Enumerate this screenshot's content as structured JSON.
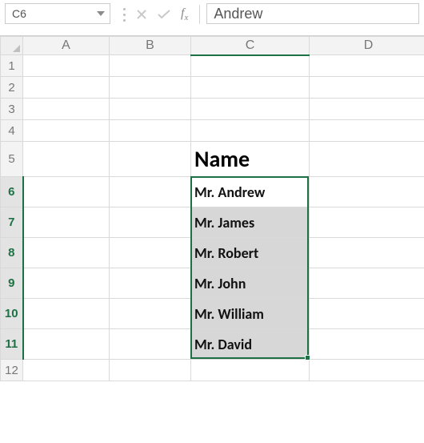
{
  "colors": {
    "accent": "#1e7145",
    "headerBg": "#f3f3f3",
    "selectionFill": "#d7d7d7"
  },
  "nameBox": {
    "value": "C6"
  },
  "formulaBar": {
    "value": "Andrew"
  },
  "columns": {
    "A": "A",
    "B": "B",
    "C": "C",
    "D": "D"
  },
  "rows": [
    "1",
    "2",
    "3",
    "4",
    "5",
    "6",
    "7",
    "8",
    "9",
    "10",
    "11",
    "12"
  ],
  "activeColumn": "C",
  "activeRows": [
    6,
    7,
    8,
    9,
    10,
    11
  ],
  "activeCell": "C6",
  "selectionRange": "C6:C11",
  "cells": {
    "C5": {
      "value": "Name",
      "style": "header"
    },
    "C6": {
      "value": "Mr. Andrew",
      "style": "data"
    },
    "C7": {
      "value": "Mr. James",
      "style": "data"
    },
    "C8": {
      "value": "Mr. Robert",
      "style": "data"
    },
    "C9": {
      "value": "Mr. John",
      "style": "data"
    },
    "C10": {
      "value": "Mr. William",
      "style": "data"
    },
    "C11": {
      "value": "Mr. David",
      "style": "data"
    }
  }
}
